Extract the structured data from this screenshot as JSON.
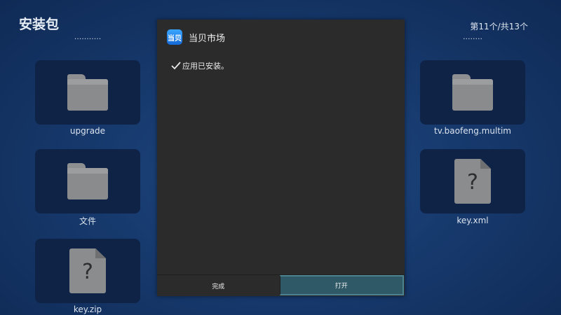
{
  "header": {
    "title": "安装包",
    "counter": "第11个/共13个"
  },
  "grid": {
    "left": [
      {
        "name": "upgrade",
        "type": "folder"
      },
      {
        "name": "文件",
        "type": "folder"
      },
      {
        "name": "key.zip",
        "type": "unknown"
      }
    ],
    "right": [
      {
        "name": "tv.baofeng.multim",
        "type": "folder"
      },
      {
        "name": "key.xml",
        "type": "unknown"
      }
    ],
    "clipped_left": "...........",
    "clipped_right": "........"
  },
  "dialog": {
    "app_icon_text": "当贝",
    "app_name": "当贝市场",
    "status": "应用已安装。",
    "buttons": {
      "done": "完成",
      "open": "打开"
    }
  },
  "colors": {
    "background": "#173a6e",
    "tile": "#0f2347",
    "dialog": "#2b2b2b",
    "primary_button": "#2f5966",
    "accent_icon": "#1e88ff"
  }
}
